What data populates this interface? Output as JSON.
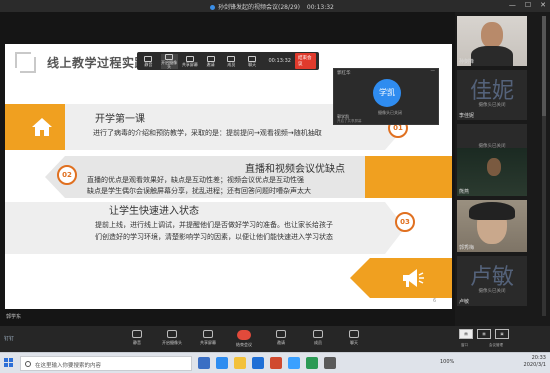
{
  "window": {
    "title": "孙剑锋发起的视频会议(28/29)",
    "elapsed": "00:13:32"
  },
  "slide": {
    "title": "线上教学过程实践",
    "section1": {
      "heading": "开学第一课",
      "body": "进行了病毒的介绍和预防教学，采取的是：提前提问→观看视频→随机抽取",
      "number": "01"
    },
    "section2": {
      "heading": "直播和视频会议优缺点",
      "line1": "直播的优点是观看效果好，缺点是互动性差；视频会议优点是互动性强",
      "line2": "缺点是学生偶尔会误触屏幕分享，扰乱进程；还有回答问题时嘈杂声太大",
      "number": "02"
    },
    "section3": {
      "heading": "让学生快速进入状态",
      "line1": "提前上线，进行线上调试，并提醒他们是否做好学习的准备。也让家长给孩子",
      "line2": "们创造好的学习环境，清楚影响学习的因素，以便让他们能快速进入学习状态",
      "number": "03"
    },
    "page_number": "6"
  },
  "meeting_toolbar": {
    "items": [
      "静音",
      "开启摄像头",
      "共享屏幕",
      "邀请",
      "成员",
      "聊天"
    ],
    "time": "00:13:32",
    "end_label": "结束会议"
  },
  "float_window": {
    "title": "郭红华",
    "avatar_text": "学凯",
    "camera_status": "摄像头已关闭",
    "name": "郭学凯",
    "sub": "开启了共享屏幕"
  },
  "stage_name": "郭学东",
  "participants": [
    {
      "name": "孙剑锋",
      "type": "photo"
    },
    {
      "name": "李佳妮",
      "big": "佳妮",
      "status": "摄像头已关闭"
    },
    {
      "name": "",
      "status": "摄像头已关闭"
    },
    {
      "name": "熊燕",
      "type": "photo"
    },
    {
      "name": "郭秀梅",
      "type": "photo"
    },
    {
      "name": "卢敏",
      "big": "卢敏",
      "status": "摄像头已关闭"
    }
  ],
  "bottom_bar": {
    "brand": "钉钉",
    "items": [
      "静音",
      "开启摄像头",
      "共享屏幕",
      "结束会议",
      "邀请",
      "成员",
      "聊天"
    ],
    "view_label": "窗口",
    "extra": "会议管理"
  },
  "taskbar": {
    "search_placeholder": "在这里输入你要搜索的内容",
    "zoom": "100%",
    "time": "20:33",
    "date": "2020/3/1"
  },
  "colors": {
    "accent": "#f0a020",
    "circle": "#e07020",
    "end": "#e24a3b",
    "avatar": "#2f8cf0"
  }
}
